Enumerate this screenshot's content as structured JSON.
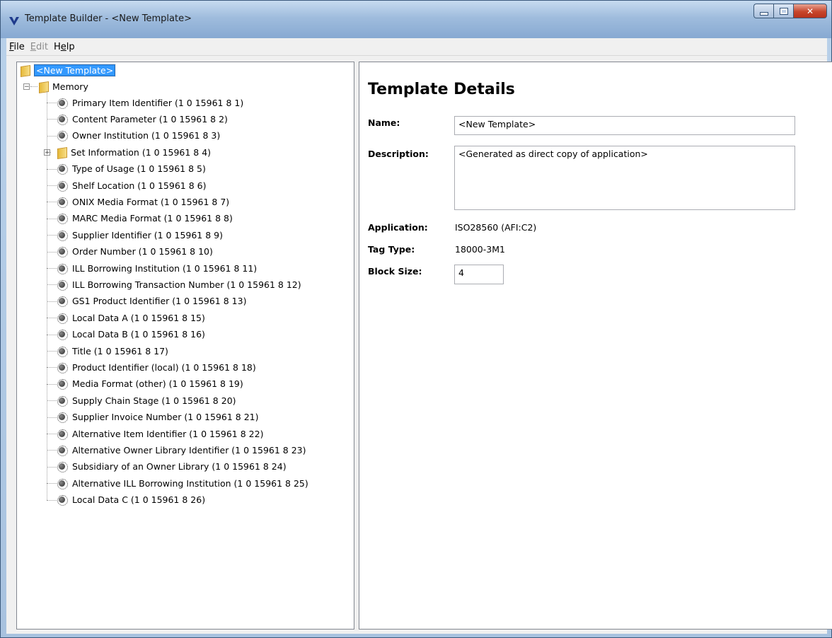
{
  "window": {
    "title": "Template Builder - <New Template>"
  },
  "menu": [
    {
      "label": "File",
      "enabled": true
    },
    {
      "label": "Edit",
      "enabled": false
    },
    {
      "label": "Help",
      "enabled": true
    }
  ],
  "tree": {
    "root_label": "<New Template>",
    "memory_label": "Memory",
    "items": [
      {
        "label": "Primary Item Identifier (1 0 15961 8 1)",
        "type": "leaf"
      },
      {
        "label": "Content Parameter (1 0 15961 8 2)",
        "type": "leaf"
      },
      {
        "label": "Owner Institution (1 0 15961 8 3)",
        "type": "leaf"
      },
      {
        "label": "Set Information (1 0 15961 8 4)",
        "type": "folder"
      },
      {
        "label": "Type of Usage (1 0 15961 8 5)",
        "type": "leaf"
      },
      {
        "label": "Shelf Location (1 0 15961 8 6)",
        "type": "leaf"
      },
      {
        "label": "ONIX Media Format (1 0 15961 8 7)",
        "type": "leaf"
      },
      {
        "label": "MARC Media Format (1 0 15961 8 8)",
        "type": "leaf"
      },
      {
        "label": "Supplier Identifier (1 0 15961 8 9)",
        "type": "leaf"
      },
      {
        "label": "Order Number (1 0 15961 8 10)",
        "type": "leaf"
      },
      {
        "label": "ILL Borrowing Institution (1 0 15961 8 11)",
        "type": "leaf"
      },
      {
        "label": "ILL Borrowing Transaction Number (1 0 15961 8 12)",
        "type": "leaf"
      },
      {
        "label": "GS1 Product Identifier (1 0 15961 8 13)",
        "type": "leaf"
      },
      {
        "label": "Local Data A (1 0 15961 8 15)",
        "type": "leaf"
      },
      {
        "label": "Local Data B (1 0 15961 8 16)",
        "type": "leaf"
      },
      {
        "label": "Title (1 0 15961 8 17)",
        "type": "leaf"
      },
      {
        "label": "Product Identifier (local) (1 0 15961 8 18)",
        "type": "leaf"
      },
      {
        "label": "Media Format (other) (1 0 15961 8 19)",
        "type": "leaf"
      },
      {
        "label": "Supply Chain Stage (1 0 15961 8 20)",
        "type": "leaf"
      },
      {
        "label": "Supplier Invoice Number (1 0 15961 8 21)",
        "type": "leaf"
      },
      {
        "label": "Alternative Item Identifier (1 0 15961 8 22)",
        "type": "leaf"
      },
      {
        "label": "Alternative Owner Library Identifier (1 0 15961 8 23)",
        "type": "leaf"
      },
      {
        "label": "Subsidiary of an Owner Library (1 0 15961 8 24)",
        "type": "leaf"
      },
      {
        "label": "Alternative ILL Borrowing Institution (1 0 15961 8 25)",
        "type": "leaf"
      },
      {
        "label": "Local Data C (1 0 15961 8 26)",
        "type": "leaf"
      }
    ]
  },
  "details": {
    "heading": "Template Details",
    "name_label": "Name:",
    "name_value": "<New Template>",
    "description_label": "Description:",
    "description_value": "<Generated as direct copy of application>",
    "application_label": "Application:",
    "application_value": "ISO28560 (AFI:C2)",
    "tag_type_label": "Tag Type:",
    "tag_type_value": "18000-3M1",
    "block_size_label": "Block Size:",
    "block_size_value": "4"
  },
  "colors": {
    "selection": "#3399ff",
    "titlebar": "#9fbcdd",
    "close_button": "#c7462c"
  }
}
